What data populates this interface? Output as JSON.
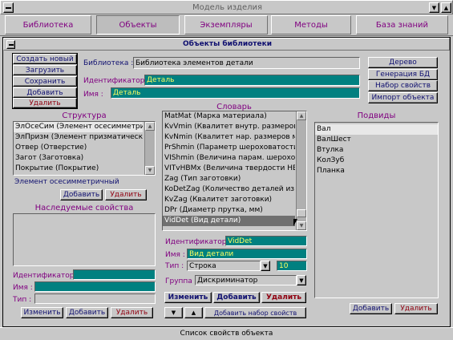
{
  "window": {
    "title": "Модель изделия"
  },
  "menu": [
    "Библиотека",
    "Объекты",
    "Экземпляры",
    "Методы",
    "База знаний"
  ],
  "panel": {
    "title": "Объекты библиотеки",
    "status": "Список свойств объекта"
  },
  "actions": {
    "create": "Создать новый",
    "load": "Загрузить",
    "save": "Сохранить",
    "add": "Добавить",
    "delete": "Удалить"
  },
  "right_actions": {
    "tree": "Дерево",
    "gen": "Генерация БД",
    "props": "Набор свойств",
    "import": "Импорт объекта"
  },
  "library": {
    "label": "Библиотека :",
    "value": "Библиотека элементов детали"
  },
  "object": {
    "id_label": "Идентификатор :",
    "id_value": "Деталь",
    "name_label": "Имя :",
    "name_value": "Деталь"
  },
  "structure": {
    "title": "Структура",
    "items": [
      "ЭлОсеСим (Элемент осесимметрич",
      "ЭлПризм (Элемент призматически",
      "Отвер (Отверстие)",
      "Загот (Заготовка)",
      "Покрытие (Покрытие)"
    ],
    "selected_text": "Элемент осесимметричный",
    "add": "Добавить",
    "delete": "Удалить"
  },
  "inherited": {
    "title": "Наследуемые свойства",
    "id_label": "Идентификатор :",
    "name_label": "Имя :",
    "type_label": "Тип :",
    "change": "Изменить",
    "add": "Добавить",
    "delete": "Удалить"
  },
  "dictionary": {
    "title": "Словарь",
    "items": [
      "MatMat (Марка материала)",
      "KvVmin (Квалитет внутр. размеров м",
      "KvNmin (Квалитет нар. размеров ми",
      "PrShmin (Параметр шероховатости п",
      "VIShmin (Величина парам. шерохова",
      "VITvHBMx (Величина твердости НВ",
      "Zag (Тип заготовки)",
      "KoDetZag (Количество деталей из заг",
      "KvZag (Квалитет заготовки)",
      "DPr (Диаметр прутка, мм)",
      "VidDet (Вид детали)"
    ],
    "id_label": "Идентификатор :",
    "id_value": "VidDet",
    "name_label": "Имя :",
    "name_value": "Вид детали",
    "type_label": "Тип :",
    "type_value": "Строка",
    "type_size": "10",
    "group_label": "Группа :",
    "group_value": "Дискриминатор",
    "change": "Изменить",
    "add": "Добавить",
    "delete": "Удалить",
    "down": "▼",
    "up": "▲",
    "add_set": "Добавить набор свойств"
  },
  "subtypes": {
    "title": "Подвиды",
    "items": [
      "Вал",
      "ВалШест",
      "Втулка",
      "КолЗуб",
      "Планка"
    ],
    "add": "Добавить",
    "delete": "Удалить"
  }
}
